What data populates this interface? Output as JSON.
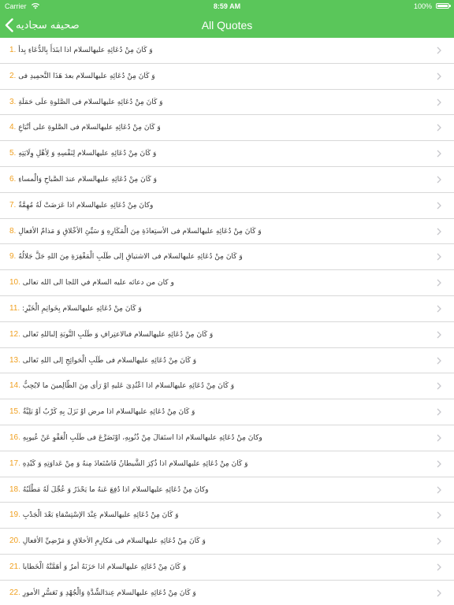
{
  "status_bar": {
    "carrier": "Carrier",
    "time": "8:59 AM",
    "battery": "100%"
  },
  "nav": {
    "back_label": "صحیفه سجادیه",
    "title": "All Quotes"
  },
  "colors": {
    "nav_background": "#5ac65a",
    "number_accent": "#f0a020",
    "chevron": "#c7c7cc",
    "separator": "#d8d8d8"
  },
  "icons": {
    "back": "chevron-left-icon",
    "row_disclosure": "chevron-right-icon",
    "wifi": "wifi-icon",
    "battery": "battery-icon"
  },
  "quotes": [
    {
      "number": "1.",
      "text": "وَ كَانَ مِنْ دُعَائِهِ عليهالسلام اذا ابتَدَأَ بِالدُّعَاءِ بِدأ"
    },
    {
      "number": "2.",
      "text": "وَ كَانَ مِنْ دُعَائِهِ عليهالسلام بعدَ هَذَا التَّحمِيدِ فى"
    },
    {
      "number": "3.",
      "text": "وَ كَانَ مِنْ دُعَائِهِ عليهالسلام فى الصَّلوةِ علَى حَمَلَةِ"
    },
    {
      "number": "4.",
      "text": "وَ كَانَ مِنْ دُعَائِهِ عليهالسلام فى الصَّلوةِ على أتْبَاعِ"
    },
    {
      "number": "5.",
      "text": "وَ كَانَ مِنْ دُعَائِهِ عليهالسلام لِنَفْسِهِ وَ لِأهْلِ وِلَايَتِهِ"
    },
    {
      "number": "6.",
      "text": "وَ كَانَ مِنْ دُعَائِهِ عليهالسلام عندَ الصَّباحِ وَالْمساءِ"
    },
    {
      "number": "7.",
      "text": "وكانَ مِنْ دُعَائِهِ عليهالسلام اذا عَرَضَتْ لَهُ مُهِمَّةٌ"
    },
    {
      "number": "8.",
      "text": "وَ كَانَ مِنْ دُعَائِهِ عليهالسلام فى الأستِعاذَةِ مِنَ الْمَكَارِهِ وَ سَيِّئِ الأخْلاقِ وَ مَذامّ الأفعالِ"
    },
    {
      "number": "9.",
      "text": "وَ كَانَ مِنْ دُعَائِهِ عليهالسلام فى الاشتياقِ إلى طَلَبِ الْمَغْفِرَةِ مِنَ اللهِ جَلَّ جَلالُهُ"
    },
    {
      "number": "10.",
      "text": "و كان من دعائه عليه السلام في اللجا الى الله تعالى"
    },
    {
      "number": "11.",
      "text": "وَ كَانَ مِنْ دُعَائِهِ عليهالسلام بِخَواتِمِ الْخَيْرِ:"
    },
    {
      "number": "12.",
      "text": "وَ كَانَ مِنْ دُعَائِهِ عليهالسلام فىالاعتِرافِ وَ طَلَبِ التَّوبَةِ إلىاللهِ تَعالى"
    },
    {
      "number": "13.",
      "text": "وَ كَانَ مِنْ دُعَائِهِ عليهالسلام فى طَلَبِ الْحَوائِجِ إلى اللهِ تَعالى"
    },
    {
      "number": "14.",
      "text": "وَ كَانَ مِنْ دُعَائِهِ عليهالسلام اذا اعْتُدِىَ عَليهِ اوْ رَأى مِنَ الظّالِمينَ ما لايُحِبُّ"
    },
    {
      "number": "15.",
      "text": "وَ كَانَ مِنْ دُعَائِهِ عليهالسلام اذا مرض اوْ نَزَلَ بِهِ كَرْبٌ اَوْ بَلِيَّةٌ"
    },
    {
      "number": "16.",
      "text": "وكانَ مِنْ دُعَائِهِ عليهالسلام اذا استَقالَ مِنْ ذُنُوبِهِ، اوْتَضَرَّعَ فى طَلَبِ الْعَفْوِ عَنْ عُيوبِهِ"
    },
    {
      "number": "17.",
      "text": "وَ كَانَ مِنْ دُعَائِهِ عليهالسلام اذا ذُكِرَ الشَّيطانُ فَاسْتَعاذَ مِنهُ وَ مِنْ عَداوَتِهِ وَ كَيْدِهِ"
    },
    {
      "number": "18.",
      "text": "وكانَ مِنْ دُعَائِهِ عليهالسلام اذا دُفِعَ عَنهُ ما يَحْذَرُ وَ عُجِّلَ لَهُ مَطْلَبُهُ"
    },
    {
      "number": "19.",
      "text": "وَ كَانَ مِنْ دُعَائِهِ عليهالسلام عِنْدَ الإسْتِسْقاءِ بَعْدَ الْجَدْبِ"
    },
    {
      "number": "20.",
      "text": "وَ كَانَ مِنْ دُعَائِهِ عليهالسلام فى مَكارِمِ الأخلاقِ وَ مَرْضِيِّ الأفعالِ"
    },
    {
      "number": "21.",
      "text": "وَ كَانَ مِنْ دُعَائِهِ عليهالسلام اذا حَزَنَهُ أمرٌ وَ أهَمَّتْهُ الْخَطايا"
    },
    {
      "number": "22.",
      "text": "وَ كَانَ مِنْ دُعَائِهِ عليهالسلام عِندَالشِّدَّةِ وَالْجُهْدِ وَ تَعَسُّرِ الأمورِ"
    }
  ]
}
